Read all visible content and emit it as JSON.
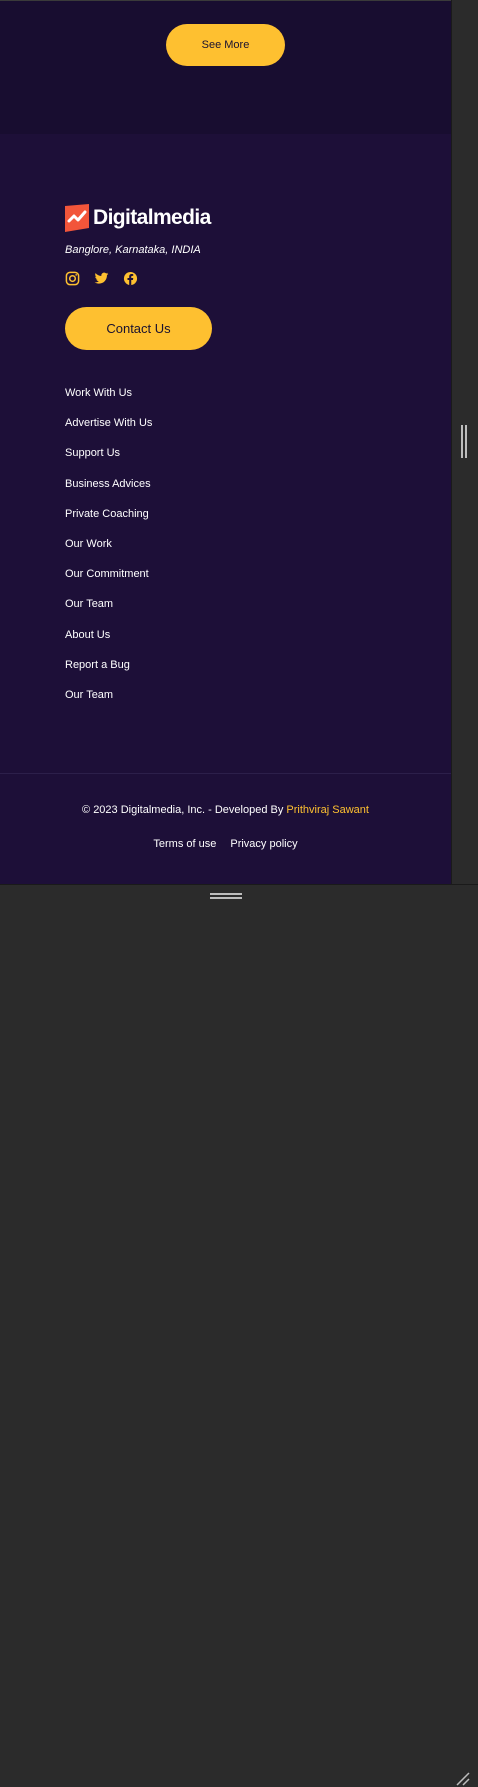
{
  "top": {
    "see_more_label": "See More"
  },
  "footer": {
    "brand": "Digitalmedia",
    "address": "Banglore, Karnataka, INDIA",
    "social": [
      "instagram-icon",
      "twitter-icon",
      "facebook-icon"
    ],
    "contact_label": "Contact Us",
    "links": [
      "Work With Us",
      "Advertise With Us",
      "Support Us",
      "Business Advices",
      "Private Coaching",
      "Our Work",
      "Our Commitment",
      "Our Team",
      "About Us",
      "Report a Bug",
      "Our Team"
    ],
    "copyright_text": "© 2023 Digitalmedia, Inc. - Developed By",
    "developer": "Prithviraj Sawant",
    "legal": {
      "terms": "Terms of use",
      "privacy": "Privacy policy"
    }
  },
  "colors": {
    "accent": "#fec030",
    "background": "#1d0f38",
    "top_background": "#180d30",
    "logo_mark": "#f2553a"
  }
}
